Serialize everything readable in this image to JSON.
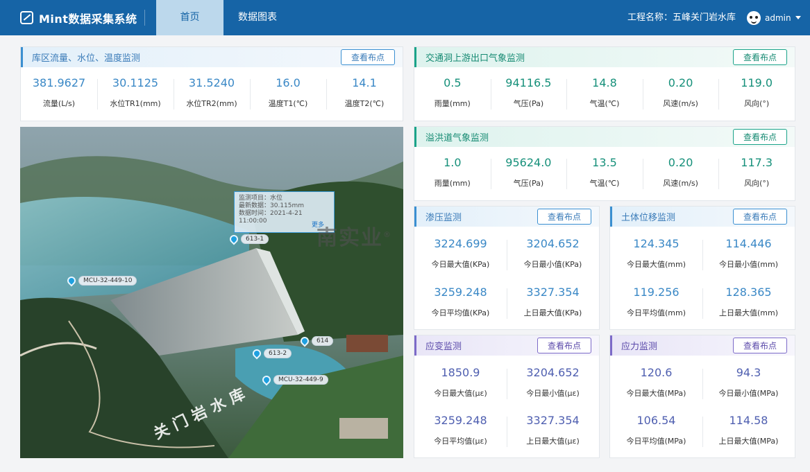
{
  "header": {
    "app_title": "Mint数据采集系统",
    "tabs": [
      {
        "label": "首页",
        "active": true
      },
      {
        "label": "数据图表",
        "active": false
      }
    ],
    "project_label": "工程名称：五峰关门岩水库",
    "user": "admin",
    "bar_color": "#1664a6"
  },
  "reservoir": {
    "title": "库区流量、水位、温度监测",
    "button": "查看布点",
    "metrics": [
      {
        "value": "381.9627",
        "label": "流量(L/s)"
      },
      {
        "value": "30.1125",
        "label": "水位TR1(mm)"
      },
      {
        "value": "31.5240",
        "label": "水位TR2(mm)"
      },
      {
        "value": "16.0",
        "label": "温度T1(℃)"
      },
      {
        "value": "14.1",
        "label": "温度T2(℃)"
      }
    ]
  },
  "tunnel_weather": {
    "title": "交通洞上游出口气象监测",
    "button": "查看布点",
    "metrics": [
      {
        "value": "0.5",
        "label": "雨量(mm)"
      },
      {
        "value": "94116.5",
        "label": "气压(Pa)"
      },
      {
        "value": "14.8",
        "label": "气温(℃)"
      },
      {
        "value": "0.20",
        "label": "风速(m/s)"
      },
      {
        "value": "119.0",
        "label": "风向(°)"
      }
    ]
  },
  "spillway_weather": {
    "title": "溢洪道气象监测",
    "button": "查看布点",
    "metrics": [
      {
        "value": "1.0",
        "label": "雨量(mm)"
      },
      {
        "value": "95624.0",
        "label": "气压(Pa)"
      },
      {
        "value": "13.5",
        "label": "气温(℃)"
      },
      {
        "value": "0.20",
        "label": "风速(m/s)"
      },
      {
        "value": "117.3",
        "label": "风向(°)"
      }
    ]
  },
  "seepage": {
    "title": "渗压监测",
    "button": "查看布点",
    "metrics": [
      {
        "value": "3224.699",
        "label": "今日最大值(KPa)"
      },
      {
        "value": "3204.652",
        "label": "今日最小值(KPa)"
      },
      {
        "value": "3259.248",
        "label": "今日平均值(KPa)"
      },
      {
        "value": "3327.354",
        "label": "上日最大值(KPa)"
      }
    ]
  },
  "displacement": {
    "title": "土体位移监测",
    "button": "查看布点",
    "metrics": [
      {
        "value": "124.345",
        "label": "今日最大值(mm)"
      },
      {
        "value": "114.446",
        "label": "今日最小值(mm)"
      },
      {
        "value": "119.256",
        "label": "今日平均值(mm)"
      },
      {
        "value": "128.365",
        "label": "上日最大值(mm)"
      }
    ]
  },
  "strain": {
    "title": "应变监测",
    "button": "查看布点",
    "metrics": [
      {
        "value": "1850.9",
        "label": "今日最大值(με)"
      },
      {
        "value": "3204.652",
        "label": "今日最小值(με)"
      },
      {
        "value": "3259.248",
        "label": "今日平均值(με)"
      },
      {
        "value": "3327.354",
        "label": "上日最大值(με)"
      }
    ]
  },
  "stress": {
    "title": "应力监测",
    "button": "查看布点",
    "metrics": [
      {
        "value": "120.6",
        "label": "今日最大值(MPa)"
      },
      {
        "value": "94.3",
        "label": "今日最小值(MPa)"
      },
      {
        "value": "106.54",
        "label": "今日平均值(MPa)"
      },
      {
        "value": "114.58",
        "label": "上日最大值(MPa)"
      }
    ]
  },
  "map": {
    "dam_name": "关门岩水库",
    "tooltip": {
      "item": "监测项目：水位",
      "latest": "最新数据：30.115mm",
      "time": "数据时间：2021-4-21 11:00:00",
      "more": "更多"
    },
    "markers": [
      "613-1",
      "MCU-32-449-10",
      "613-2",
      "614",
      "MCU-32-449-9"
    ]
  },
  "watermark": {
    "text": "南实业",
    "mark": "®"
  }
}
